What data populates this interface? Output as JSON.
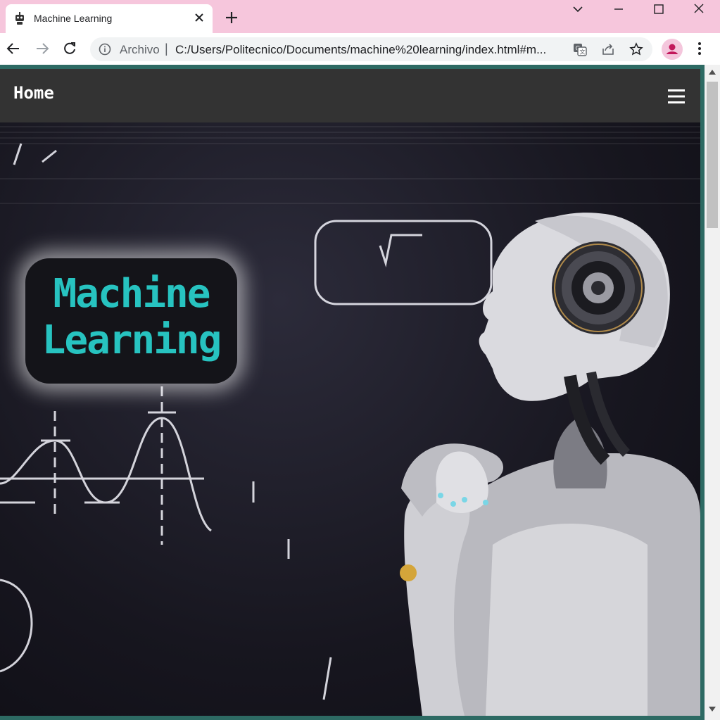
{
  "browser": {
    "tab": {
      "title": "Machine Learning",
      "favicon": "robot-icon"
    },
    "window_controls": [
      "tab-search-icon",
      "minimize-icon",
      "maximize-icon",
      "close-icon"
    ],
    "toolbar": {
      "site_info_label": "Archivo",
      "separator": "|",
      "url": "C:/Users/Politecnico/Documents/machine%20learning/index.html#m...",
      "actions": [
        "translate-icon",
        "share-icon",
        "bookmark-star-icon"
      ]
    },
    "colors": {
      "tabstrip": "#f6c6dc",
      "profile_avatar": "#c2185b"
    }
  },
  "site": {
    "nav": {
      "home_label": "Home",
      "menu_icon": "hamburger-icon"
    },
    "hero": {
      "title_line1": "Machine",
      "title_line2": "Learning",
      "background": "robot thinking in front of chalkboard with math formulas"
    },
    "colors": {
      "nav_bg": "#333333",
      "title_text": "#27c3c0",
      "title_box": "#141419",
      "frame_border": "#2d6a63"
    }
  }
}
